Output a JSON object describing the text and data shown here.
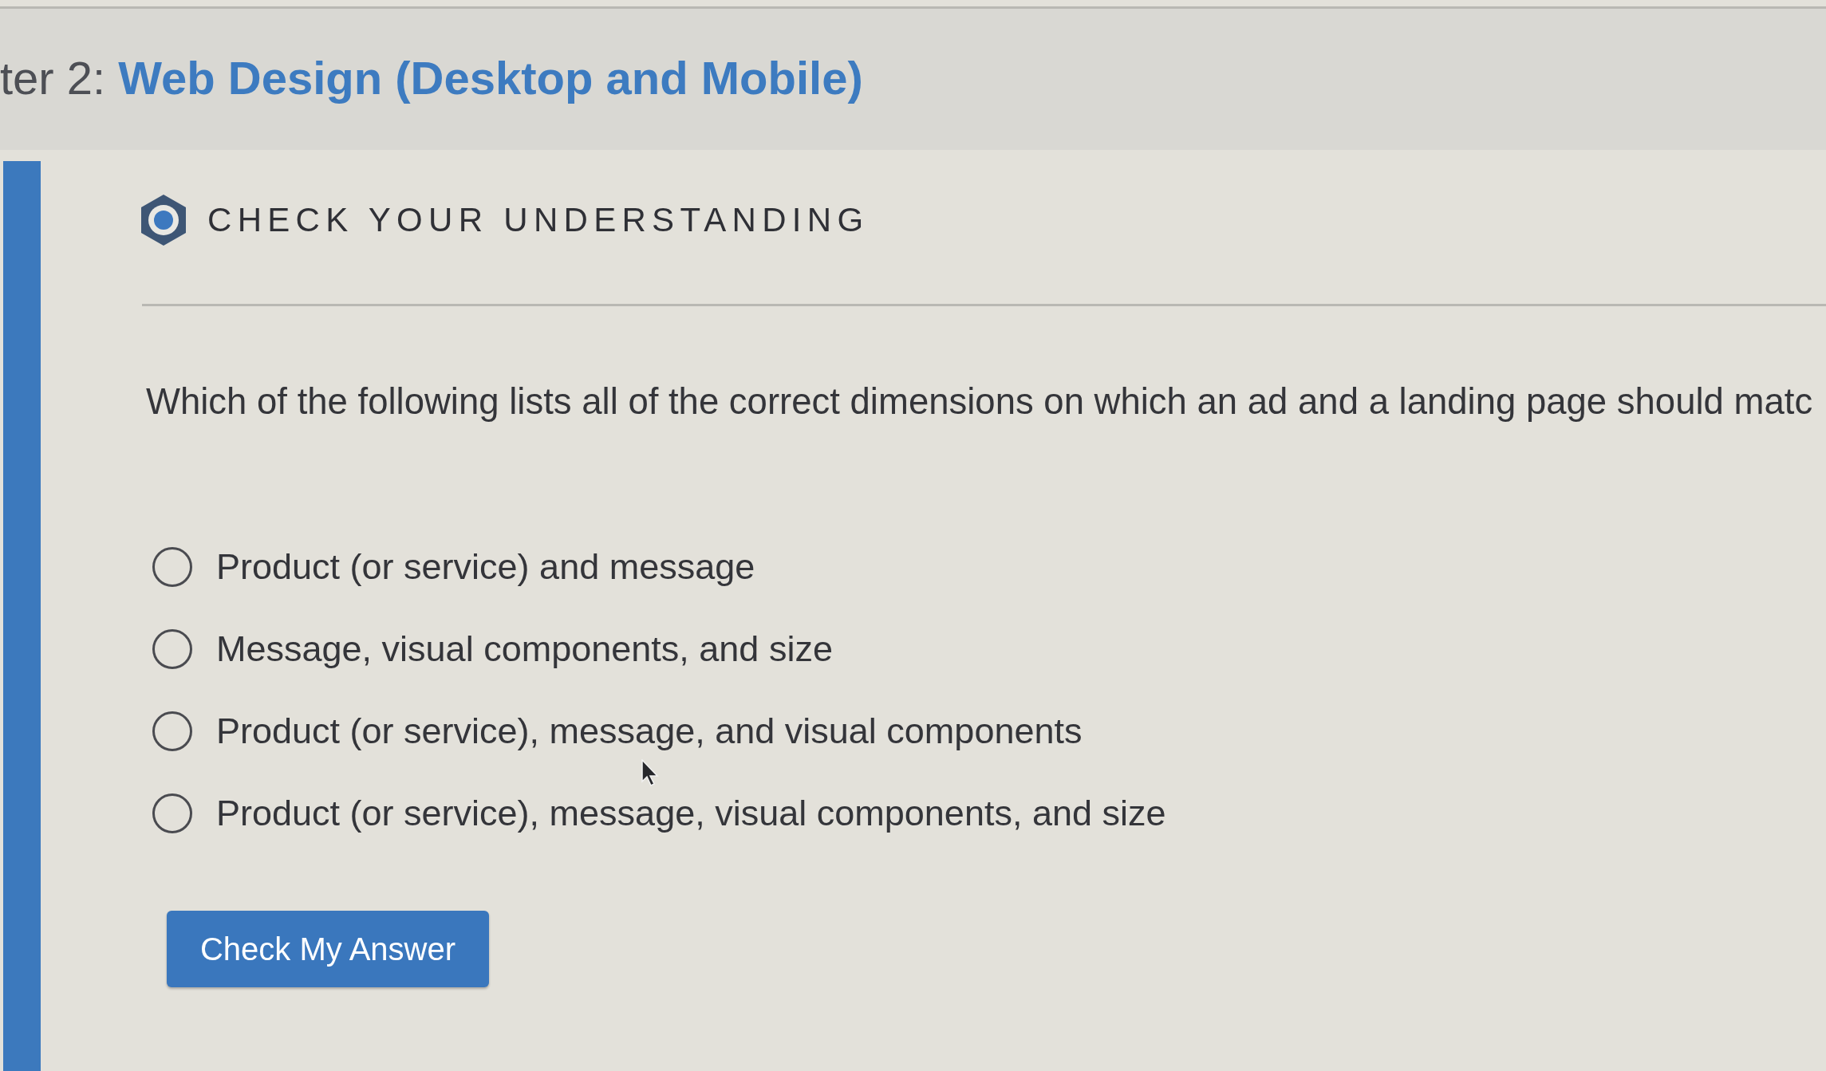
{
  "header": {
    "title": "ter 2: **Web Design (Desktop and Mobile)**"
  },
  "section": {
    "heading": "CHECK YOUR UNDERSTANDING"
  },
  "question": {
    "text": "Which of the following lists all of the correct dimensions on which an ad and a landing page should matc",
    "options": [
      {
        "label": "Product (or service) and message",
        "selected": false
      },
      {
        "label": "Message, visual components, and size",
        "selected": false
      },
      {
        "label": "Product (or service), message, and visual components",
        "selected": false
      },
      {
        "label": "Product (or service), message, visual components, and size",
        "selected": false
      }
    ]
  },
  "submit_button": {
    "label": "Check My Answer"
  }
}
